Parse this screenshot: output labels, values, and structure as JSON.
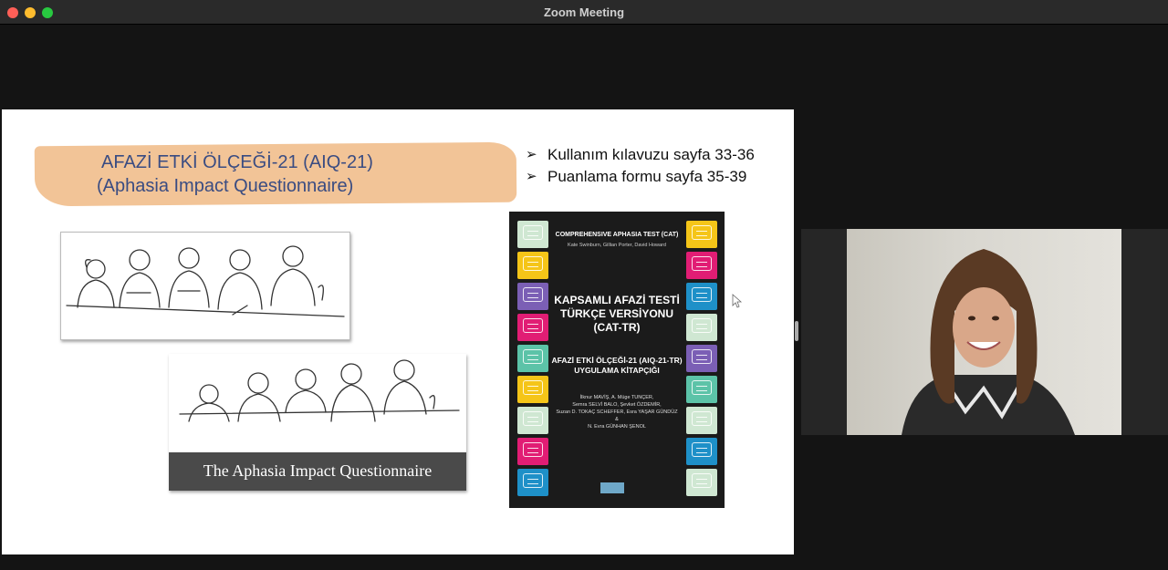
{
  "window": {
    "title": "Zoom Meeting"
  },
  "slide": {
    "banner": {
      "line1": "AFAZİ ETKİ ÖLÇEĞİ-21 (AIQ-21)",
      "line2": "(Aphasia Impact Questionnaire)"
    },
    "bullets": [
      {
        "arrow": "➢",
        "text": "Kullanım kılavuzu sayfa 33-36"
      },
      {
        "arrow": "➢",
        "text": "Puanlama formu sayfa 35-39"
      }
    ],
    "image2_caption": "The Aphasia Impact Questionnaire",
    "book": {
      "series": "COMPREHENSIVE APHASIA TEST (CAT)",
      "authors": "Kate Swinburn, Gillian Porter, David Howard",
      "title_l1": "KAPSAMLI AFAZİ TESTİ",
      "title_l2": "TÜRKÇE VERSİYONU",
      "title_l3": "(CAT-TR)",
      "subtitle_l1": "AFAZİ ETKİ ÖLÇEĞİ-21 (AIQ-21-TR)",
      "subtitle_l2": "UYGULAMA KİTAPÇIĞI",
      "editors_l1": "İlknur MAVİŞ, A. Müge TUNÇER,",
      "editors_l2": "Semra SELVİ BALO, Şevket ÖZDEMİR,",
      "editors_l3": "Suzan D. TOKAÇ SCHEFFER, Esra YAŞAR GÜNDÜZ",
      "editors_l4": "&",
      "editors_l5": "N. Evra GÜNHAN ŞENOL",
      "left_bubble_colors": [
        "#cfe7d2",
        "#f5c518",
        "#7b5fb5",
        "#e11d74",
        "#5cc3a8",
        "#f5c518",
        "#cfe7d2",
        "#e11d74",
        "#1e90c8"
      ],
      "right_bubble_colors": [
        "#f5c518",
        "#e11d74",
        "#1e90c8",
        "#cfe7d2",
        "#7b5fb5",
        "#5cc3a8",
        "#cfe7d2",
        "#1e90c8",
        "#cfe7d2"
      ]
    }
  },
  "colors": {
    "banner": "#f2c497",
    "banner_text": "#3a4c82",
    "caption_bar": "#4a4a4a"
  },
  "icons": {
    "close": "close-icon",
    "minimize": "minimize-icon",
    "maximize": "maximize-icon",
    "cursor": "cursor-icon"
  }
}
